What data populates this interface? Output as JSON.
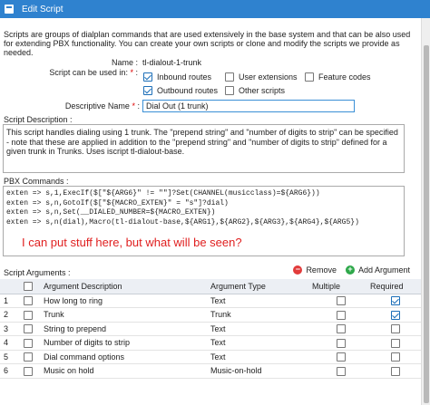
{
  "window": {
    "title": "Edit Script"
  },
  "intro": "Scripts are groups of dialplan commands that are used extensively in the base system and that can be also used for extending PBX functionality. You can create your own scripts or clone and modify the scripts we provide as needed.",
  "name_field": {
    "label": "Name :",
    "value": "tl-dialout-1-trunk"
  },
  "usage": {
    "label": "Script can be used in:",
    "required_mark": "*",
    "options": [
      {
        "label": "Inbound routes",
        "checked": true
      },
      {
        "label": "User extensions",
        "checked": false
      },
      {
        "label": "Feature codes",
        "checked": false
      },
      {
        "label": "Outbound routes",
        "checked": true
      },
      {
        "label": "Other scripts",
        "checked": false
      }
    ]
  },
  "descriptive_name": {
    "label": "Descriptive Name",
    "required_mark": "*",
    "separator": ":",
    "value": "Dial Out (1 trunk)"
  },
  "script_description": {
    "label": "Script Description :",
    "value": "This script handles dialing using 1 trunk. The \"prepend string\" and \"number of digits to strip\" can be specified - note that these are applied in addition to the \"prepend string\" and \"number of digits to strip\" defined for a given trunk in Trunks. Uses iscript tl-dialout-base."
  },
  "pbx_commands": {
    "label": "PBX Commands :",
    "lines": [
      "exten => s,1,ExecIf($[\"${ARG6}\" != \"\"]?Set(CHANNEL(musicclass)=${ARG6}))",
      "exten => s,n,GotoIf($[\"${MACRO_EXTEN}\" = \"s\"]?dial)",
      "exten => s,n,Set(__DIALED_NUMBER=${MACRO_EXTEN})",
      "exten => s,n(dial),Macro(tl-dialout-base,${ARG1},${ARG2},${ARG3},${ARG4},${ARG5})"
    ],
    "overlay_note": "I can put stuff here, but what will be seen?"
  },
  "script_arguments": {
    "label": "Script Arguments :",
    "remove_label": "Remove",
    "add_label": "Add Argument",
    "columns": [
      "Argument Description",
      "Argument Type",
      "Multiple",
      "Required"
    ],
    "rows": [
      {
        "num": "1",
        "desc": "How long to ring",
        "type": "Text",
        "multiple": false,
        "required": true
      },
      {
        "num": "2",
        "desc": "Trunk",
        "type": "Trunk",
        "multiple": false,
        "required": true
      },
      {
        "num": "3",
        "desc": "String to prepend",
        "type": "Text",
        "multiple": false,
        "required": false
      },
      {
        "num": "4",
        "desc": "Number of digits to strip",
        "type": "Text",
        "multiple": false,
        "required": false
      },
      {
        "num": "5",
        "desc": "Dial command options",
        "type": "Text",
        "multiple": false,
        "required": false
      },
      {
        "num": "6",
        "desc": "Music on hold",
        "type": "Music-on-hold",
        "multiple": false,
        "required": false
      }
    ]
  }
}
